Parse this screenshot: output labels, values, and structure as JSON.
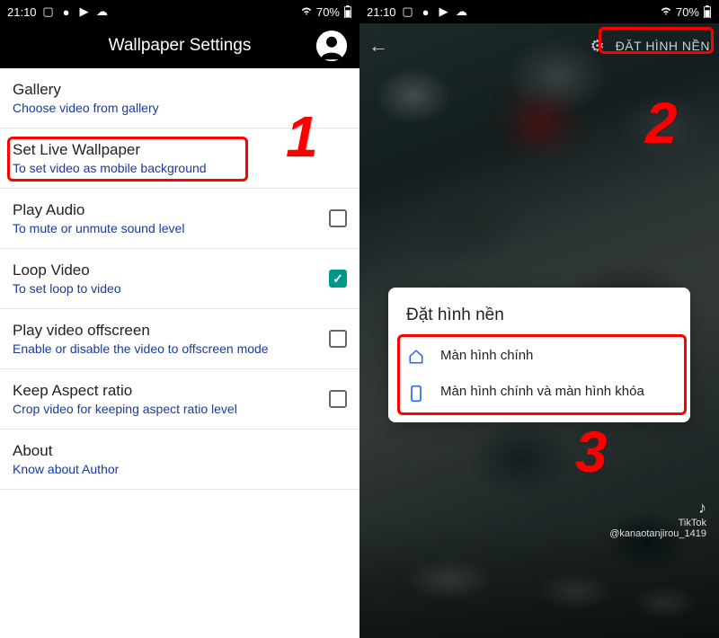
{
  "statusbar": {
    "time": "21:10",
    "battery": "70%",
    "icons": [
      "picture",
      "dot",
      "youtube",
      "cloud"
    ]
  },
  "left": {
    "header_title": "Wallpaper Settings",
    "items": [
      {
        "title": "Gallery",
        "sub": "Choose video from gallery",
        "has_checkbox": false
      },
      {
        "title": "Set Live Wallpaper",
        "sub": "To set video as mobile background",
        "has_checkbox": false
      },
      {
        "title": "Play Audio",
        "sub": "To mute or unmute sound level",
        "has_checkbox": true,
        "checked": false
      },
      {
        "title": "Loop Video",
        "sub": "To set loop to video",
        "has_checkbox": true,
        "checked": true
      },
      {
        "title": "Play video offscreen",
        "sub": "Enable or disable the video to offscreen mode",
        "has_checkbox": true,
        "checked": false
      },
      {
        "title": "Keep Aspect ratio",
        "sub": "Crop video for keeping aspect ratio level",
        "has_checkbox": true,
        "checked": false
      },
      {
        "title": "About",
        "sub": "Know about Author",
        "has_checkbox": false
      }
    ]
  },
  "right": {
    "apply_label": "ĐẶT HÌNH NỀN",
    "dialog": {
      "title": "Đặt hình nền",
      "options": [
        {
          "icon": "home",
          "label": "Màn hình chính"
        },
        {
          "icon": "phone",
          "label": "Màn hình chính và màn hình khóa"
        }
      ]
    },
    "watermark": {
      "brand": "TikTok",
      "user": "@kanaotanjirou_1419"
    }
  },
  "annotations": {
    "num1": "1",
    "num2": "2",
    "num3": "3"
  }
}
